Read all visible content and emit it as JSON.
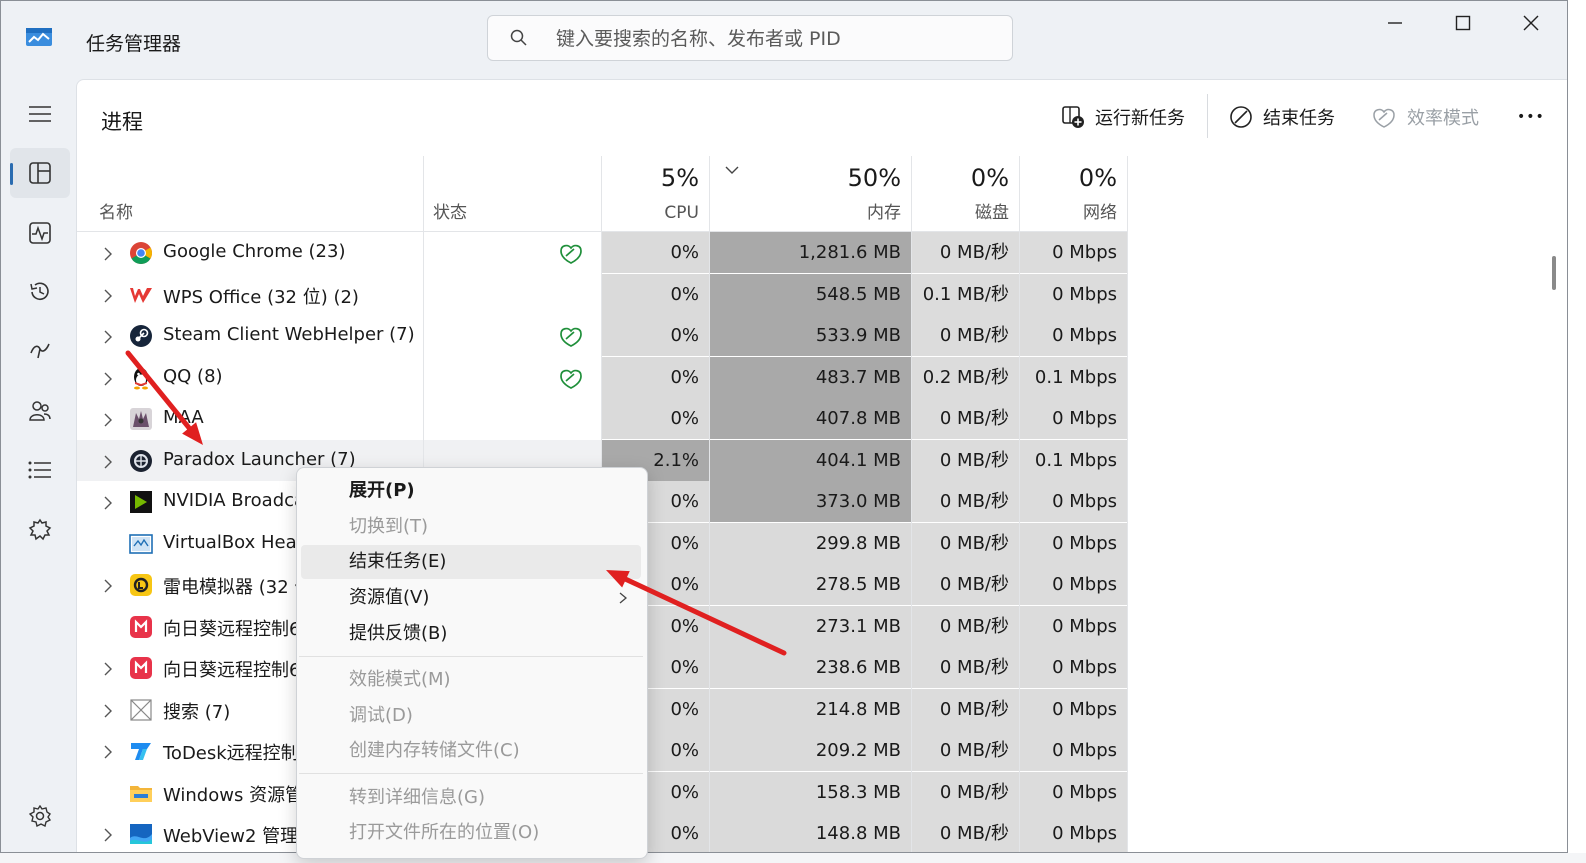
{
  "app_title": "任务管理器",
  "search": {
    "placeholder": "键入要搜索的名称、发布者或 PID"
  },
  "page_title": "进程",
  "commands": {
    "run_new_task": "运行新任务",
    "end_task": "结束任务",
    "efficiency_mode": "效率模式",
    "more": "•••"
  },
  "columns": {
    "name": "名称",
    "status": "状态",
    "cpu": {
      "percent": "5%",
      "label": "CPU"
    },
    "memory": {
      "percent": "50%",
      "label": "内存"
    },
    "disk": {
      "percent": "0%",
      "label": "磁盘"
    },
    "network": {
      "percent": "0%",
      "label": "网络"
    }
  },
  "processes": [
    {
      "name": "Google Chrome (23)",
      "cpu": "0%",
      "memory": "1,281.6 MB",
      "disk": "0 MB/秒",
      "network": "0 Mbps",
      "icon": "chrome-icon",
      "efficiency": true,
      "expandable": true
    },
    {
      "name": "WPS Office (32 位) (2)",
      "cpu": "0%",
      "memory": "548.5 MB",
      "disk": "0.1 MB/秒",
      "network": "0 Mbps",
      "icon": "wps-icon",
      "efficiency": false,
      "expandable": true
    },
    {
      "name": "Steam Client WebHelper (7)",
      "cpu": "0%",
      "memory": "533.9 MB",
      "disk": "0 MB/秒",
      "network": "0 Mbps",
      "icon": "steam-icon",
      "efficiency": true,
      "expandable": true
    },
    {
      "name": "QQ (8)",
      "cpu": "0%",
      "memory": "483.7 MB",
      "disk": "0.2 MB/秒",
      "network": "0.1 Mbps",
      "icon": "qq-icon",
      "efficiency": true,
      "expandable": true
    },
    {
      "name": "MAA",
      "cpu": "0%",
      "memory": "407.8 MB",
      "disk": "0 MB/秒",
      "network": "0 Mbps",
      "icon": "maa-icon",
      "efficiency": false,
      "expandable": true
    },
    {
      "name": "Paradox Launcher (7)",
      "cpu": "2.1%",
      "memory": "404.1 MB",
      "disk": "0 MB/秒",
      "network": "0.1 Mbps",
      "icon": "paradox-icon",
      "efficiency": false,
      "expandable": true
    },
    {
      "name": "NVIDIA Broadca",
      "cpu": "0%",
      "memory": "373.0 MB",
      "disk": "0 MB/秒",
      "network": "0 Mbps",
      "icon": "nvidia-icon",
      "efficiency": false,
      "expandable": true
    },
    {
      "name": "VirtualBox Heac",
      "cpu": "0%",
      "memory": "299.8 MB",
      "disk": "0 MB/秒",
      "network": "0 Mbps",
      "icon": "virtualbox-icon",
      "efficiency": false,
      "expandable": false
    },
    {
      "name": "雷电模拟器 (32 位",
      "cpu": "0%",
      "memory": "278.5 MB",
      "disk": "0 MB/秒",
      "network": "0 Mbps",
      "icon": "ldplayer-icon",
      "efficiency": false,
      "expandable": true
    },
    {
      "name": "向日葵远程控制6",
      "cpu": "0%",
      "memory": "273.1 MB",
      "disk": "0 MB/秒",
      "network": "0 Mbps",
      "icon": "sunlogin-icon",
      "efficiency": false,
      "expandable": false
    },
    {
      "name": "向日葵远程控制6",
      "cpu": "0%",
      "memory": "238.6 MB",
      "disk": "0 MB/秒",
      "network": "0 Mbps",
      "icon": "sunlogin-icon",
      "efficiency": false,
      "expandable": true
    },
    {
      "name": "搜索 (7)",
      "cpu": "0%",
      "memory": "214.8 MB",
      "disk": "0 MB/秒",
      "network": "0 Mbps",
      "icon": "search-app-icon",
      "efficiency": false,
      "expandable": true
    },
    {
      "name": "ToDesk远程控制",
      "cpu": "0%",
      "memory": "209.2 MB",
      "disk": "0 MB/秒",
      "network": "0 Mbps",
      "icon": "todesk-icon",
      "efficiency": false,
      "expandable": true
    },
    {
      "name": "Windows 资源管",
      "cpu": "0%",
      "memory": "158.3 MB",
      "disk": "0 MB/秒",
      "network": "0 Mbps",
      "icon": "folder-icon",
      "efficiency": false,
      "expandable": false
    },
    {
      "name": "WebView2 管理",
      "cpu": "0%",
      "memory": "148.8 MB",
      "disk": "0 MB/秒",
      "network": "0 Mbps",
      "icon": "webview-icon",
      "efficiency": false,
      "expandable": true
    }
  ],
  "context_menu": [
    {
      "label": "展开(P)",
      "state": "bold"
    },
    {
      "label": "切换到(T)",
      "state": "disabled"
    },
    {
      "label": "结束任务(E)",
      "state": "hover"
    },
    {
      "label": "资源值(V)",
      "state": "submenu"
    },
    {
      "label": "提供反馈(B)",
      "state": "normal"
    },
    {
      "label": "效能模式(M)",
      "state": "disabled"
    },
    {
      "label": "调试(D)",
      "state": "disabled"
    },
    {
      "label": "创建内存转储文件(C)",
      "state": "disabled"
    },
    {
      "label": "转到详细信息(G)",
      "state": "disabled"
    },
    {
      "label": "打开文件所在的位置(O)",
      "state": "disabled"
    }
  ],
  "heat_colors": {
    "cpu_light": "#dadada",
    "cpu_active": "#a9a9a9",
    "mem_high": "#a9a9a9",
    "mem_light": "#dadada",
    "io_light": "#dcdcdc"
  },
  "annotation_color": "#e02020"
}
